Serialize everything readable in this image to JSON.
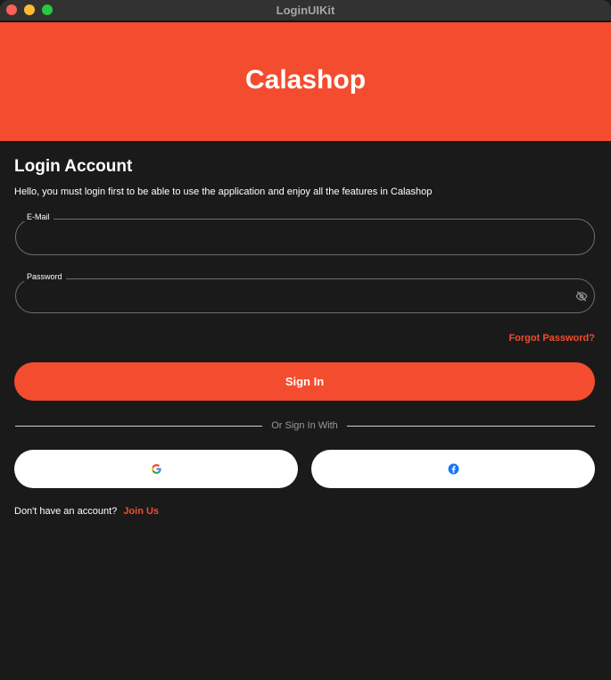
{
  "window": {
    "title": "LoginUIKit"
  },
  "header": {
    "brand": "Calashop"
  },
  "login": {
    "heading": "Login Account",
    "subtitle": "Hello, you must login first to be able to use the application and enjoy all the features in Calashop",
    "email_label": "E-Mail",
    "email_value": "",
    "password_label": "Password",
    "password_value": "",
    "forgot_label": "Forgot Password?",
    "signin_label": "Sign In",
    "divider_text": "Or Sign In With",
    "google_icon": "google-icon",
    "facebook_icon": "facebook-icon",
    "no_account_text": "Don't have an account?",
    "join_label": "Join Us"
  },
  "colors": {
    "accent": "#f44c2e",
    "background": "#1a1a1a",
    "social_button": "#ffffff",
    "field_border": "#6e6e6e"
  }
}
